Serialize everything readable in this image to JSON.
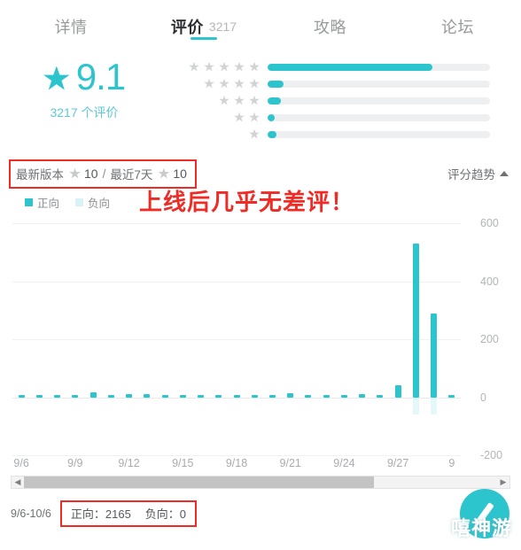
{
  "tabs": [
    {
      "label": "详情",
      "count": "",
      "active": false
    },
    {
      "label": "评价",
      "count": "3217",
      "active": true
    },
    {
      "label": "攻略",
      "count": "",
      "active": false
    },
    {
      "label": "论坛",
      "count": "",
      "active": false
    }
  ],
  "score": {
    "value": "9.1",
    "star_icon": "star-icon",
    "subtitle": "3217 个评价"
  },
  "rating_bars": [
    {
      "stars": 5,
      "percent": 74
    },
    {
      "stars": 4,
      "percent": 7
    },
    {
      "stars": 3,
      "percent": 6
    },
    {
      "stars": 2,
      "percent": 3
    },
    {
      "stars": 1,
      "percent": 4
    }
  ],
  "version_filter": {
    "latest_label": "最新版本",
    "latest_value": "10",
    "separator": "/",
    "recent_label": "最近7天",
    "recent_value": "10",
    "highlight_color": "#ee2b24"
  },
  "trend_toggle": {
    "label": "评分趋势",
    "caret_icon": "caret-up-icon"
  },
  "legend": [
    {
      "label": "正向",
      "color": "#2cc5ce"
    },
    {
      "label": "负向",
      "color": "#d8f3f6"
    }
  ],
  "annotation": {
    "text": "上线后几乎无差评！",
    "color": "#ee2b24"
  },
  "chart_data": {
    "type": "bar",
    "title": "评分趋势",
    "xlabel": "",
    "ylabel": "",
    "ylim": [
      -200,
      600
    ],
    "yticks": [
      "600",
      "400",
      "200",
      "0",
      "-200"
    ],
    "grid": true,
    "legend_position": "top-left",
    "xtick_labels": [
      "9/6",
      "9/9",
      "9/12",
      "9/15",
      "9/18",
      "9/21",
      "9/24",
      "9/27",
      "9"
    ],
    "categories": [
      "9/6",
      "9/7",
      "9/8",
      "9/9",
      "9/10",
      "9/11",
      "9/12",
      "9/13",
      "9/14",
      "9/15",
      "9/16",
      "9/17",
      "9/18",
      "9/19",
      "9/20",
      "9/21",
      "9/22",
      "9/23",
      "9/24",
      "9/25",
      "9/26",
      "9/27",
      "9/28",
      "9/29",
      "9/30"
    ],
    "series": [
      {
        "name": "正向",
        "color": "#2cc5ce",
        "values": [
          6,
          1,
          1,
          2,
          16,
          9,
          11,
          10,
          2,
          1,
          1,
          1,
          1,
          1,
          6,
          14,
          8,
          7,
          6,
          12,
          5,
          40,
          530,
          290,
          8
        ]
      },
      {
        "name": "负向",
        "color": "#d8f3f6",
        "values": [
          0,
          0,
          0,
          0,
          0,
          0,
          0,
          0,
          0,
          0,
          0,
          0,
          0,
          0,
          0,
          0,
          0,
          0,
          0,
          0,
          0,
          0,
          -60,
          -60,
          0
        ]
      }
    ]
  },
  "scrollbar": {
    "left_arrow_icon": "chevron-left-icon",
    "right_arrow_icon": "chevron-right-icon",
    "thumb_percent": 74
  },
  "footer": {
    "date_range": "9/6-10/6",
    "positive_label": "正向：2165",
    "negative_label": "负向：0",
    "highlight_color": "#ee2b24"
  },
  "fab": {
    "icon": "pencil-icon",
    "color": "#2cc5ce"
  },
  "watermark": {
    "text": "嘻神游"
  }
}
